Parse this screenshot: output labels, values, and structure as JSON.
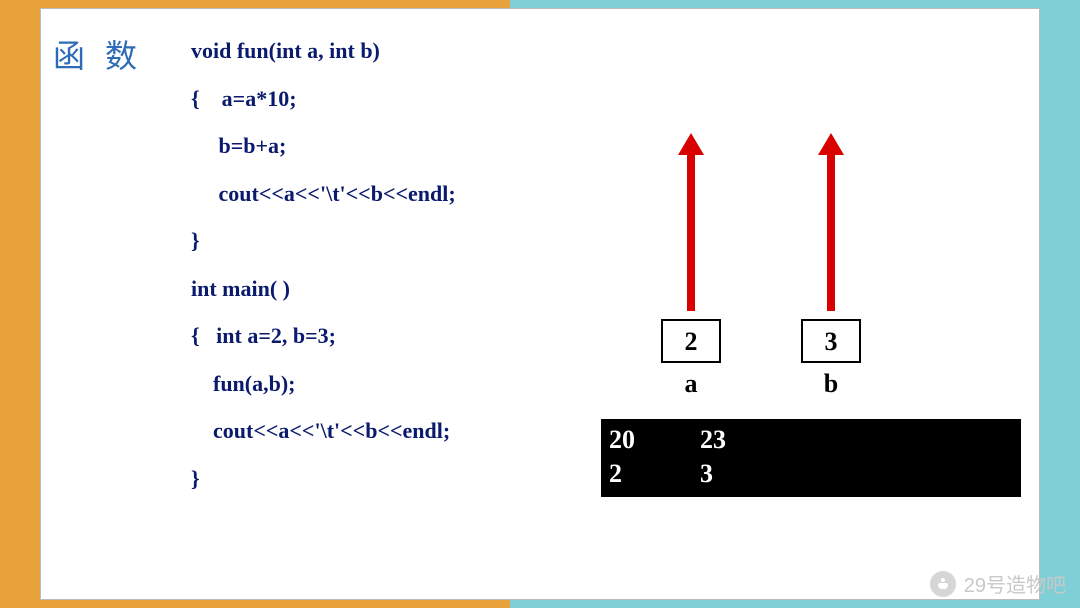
{
  "title": "函 数",
  "code": {
    "l1": "void fun(int a, int b)",
    "l2": "{    a=a*10;",
    "l3": "     b=b+a;",
    "l4": "     cout<<a<<'\\t'<<b<<endl;",
    "l5": "}",
    "l6": "int main( )",
    "l7": "{   int a=2, b=3;",
    "l8": "    fun(a,b);",
    "l9": "    cout<<a<<'\\t'<<b<<endl;",
    "l10": "}"
  },
  "diagram": {
    "boxA": "2",
    "boxB": "3",
    "labelA": "a",
    "labelB": "b"
  },
  "console": {
    "line1": "20          23",
    "line2": "2            3"
  },
  "watermark": "29号造物吧"
}
